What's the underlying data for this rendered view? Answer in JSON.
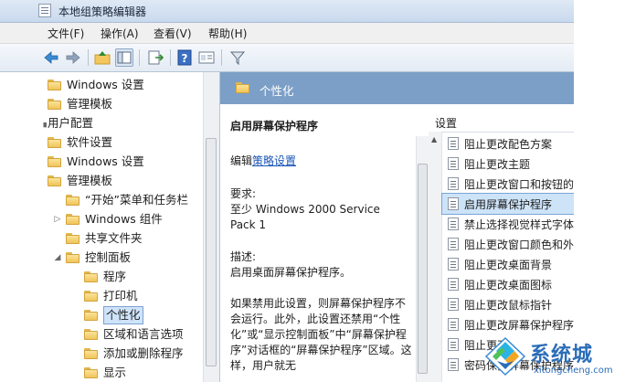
{
  "window": {
    "title": "本地组策略编辑器"
  },
  "menu": [
    "文件(F)",
    "操作(A)",
    "查看(V)",
    "帮助(H)"
  ],
  "toolbar": {
    "buttons": [
      "back-icon",
      "forward-icon",
      "up-folder-icon",
      "show-hide-tree-icon",
      "export-icon",
      "help-icon",
      "properties-icon",
      "filter-icon"
    ]
  },
  "tree": {
    "items": [
      {
        "label": "Windows 设置",
        "depth": 0
      },
      {
        "label": "管理模板",
        "depth": 0
      },
      {
        "label": "用户配置",
        "depth": -1
      },
      {
        "label": "软件设置",
        "depth": 0
      },
      {
        "label": "Windows 设置",
        "depth": 0
      },
      {
        "label": "管理模板",
        "depth": 0
      },
      {
        "label": "“开始”菜单和任务栏",
        "depth": 1
      },
      {
        "label": "Windows 组件",
        "depth": 1,
        "expander": "▷"
      },
      {
        "label": "共享文件夹",
        "depth": 1
      },
      {
        "label": "控制面板",
        "depth": 1,
        "expander": "◢"
      },
      {
        "label": "程序",
        "depth": 2
      },
      {
        "label": "打印机",
        "depth": 2
      },
      {
        "label": "个性化",
        "depth": 2,
        "selected": true
      },
      {
        "label": "区域和语言选项",
        "depth": 2
      },
      {
        "label": "添加或删除程序",
        "depth": 2
      },
      {
        "label": "显示",
        "depth": 2
      }
    ]
  },
  "category": {
    "title": "个性化"
  },
  "description": {
    "heading": "启用屏幕保护程序",
    "edit_prefix": "编辑",
    "edit_link": "策略设置",
    "requirements_label": "要求:",
    "requirements": "至少 Windows 2000 Service Pack 1",
    "desc_label": "描述:",
    "desc_text": "启用桌面屏幕保护程序。",
    "body": "如果禁用此设置，则屏幕保护程序不会运行。此外，此设置还禁用“个性化”或“显示控制面板”中“屏幕保护程序”对话框的“屏幕保护程序”区域。这样，用户就无"
  },
  "list": {
    "header": "设置",
    "items": [
      {
        "label": "阻止更改配色方案"
      },
      {
        "label": "阻止更改主题"
      },
      {
        "label": "阻止更改窗口和按钮的样"
      },
      {
        "label": "启用屏幕保护程序",
        "selected": true
      },
      {
        "label": "禁止选择视觉样式字体大"
      },
      {
        "label": "阻止更改窗口颜色和外观"
      },
      {
        "label": "阻止更改桌面背景"
      },
      {
        "label": "阻止更改桌面图标"
      },
      {
        "label": "阻止更改鼠标指针"
      },
      {
        "label": "阻止更改屏幕保护程序"
      },
      {
        "label": "阻止更改"
      },
      {
        "label": "密码保护屏幕保护程序"
      }
    ]
  },
  "watermark": {
    "text": "系统城",
    "sub": "xitongcheng.com"
  },
  "colors": {
    "category_header": "#7c9fc7",
    "selection": "#cde3f8",
    "link": "#1a56b8"
  }
}
